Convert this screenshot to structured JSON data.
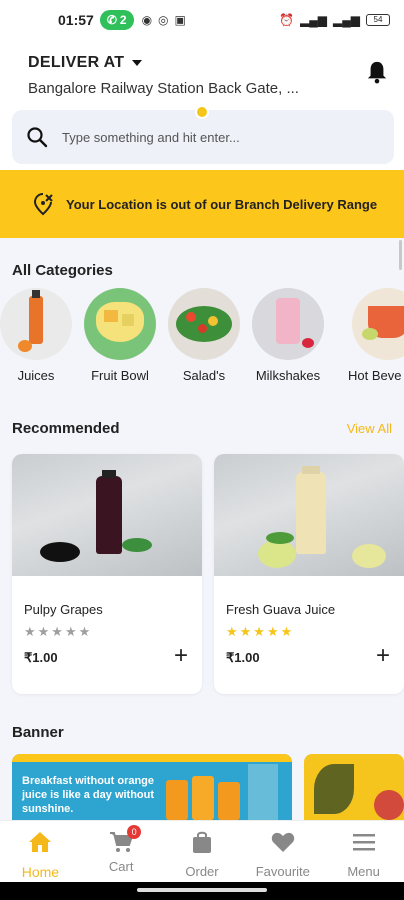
{
  "status_bar": {
    "time": "01:57",
    "call_count": "2",
    "battery": "54"
  },
  "header": {
    "deliver_label": "DELIVER AT",
    "address": "Bangalore Railway Station Back Gate, ..."
  },
  "search": {
    "placeholder": "Type something and hit enter..."
  },
  "alert": {
    "message": "Your Location is out of our Branch Delivery Range"
  },
  "categories": {
    "title": "All Categories",
    "items": [
      {
        "label": "Juices"
      },
      {
        "label": "Fruit Bowl"
      },
      {
        "label": "Salad's"
      },
      {
        "label": "Milkshakes"
      },
      {
        "label": "Hot Beve"
      }
    ]
  },
  "recommended": {
    "title": "Recommended",
    "view_all": "View All",
    "products": [
      {
        "name": "Pulpy Grapes",
        "price": "₹1.00",
        "rating": 0,
        "stars": "★★★★★"
      },
      {
        "name": "Fresh Guava Juice",
        "price": "₹1.00",
        "rating": 5,
        "stars": "★★★★★"
      }
    ]
  },
  "banner": {
    "title": "Banner",
    "text": "Breakfast without orange juice is like a day without sunshine."
  },
  "bottom_nav": {
    "items": [
      {
        "label": "Home",
        "icon": "home-icon",
        "active": true
      },
      {
        "label": "Cart",
        "icon": "cart-icon",
        "badge": "0"
      },
      {
        "label": "Order",
        "icon": "bag-icon"
      },
      {
        "label": "Favourite",
        "icon": "heart-icon"
      },
      {
        "label": "Menu",
        "icon": "menu-icon"
      }
    ]
  },
  "colors": {
    "accent": "#fcc61b",
    "accent_text": "#f5b81a",
    "active_star": "#f5c518",
    "inactive_star": "#9e9e9e"
  }
}
